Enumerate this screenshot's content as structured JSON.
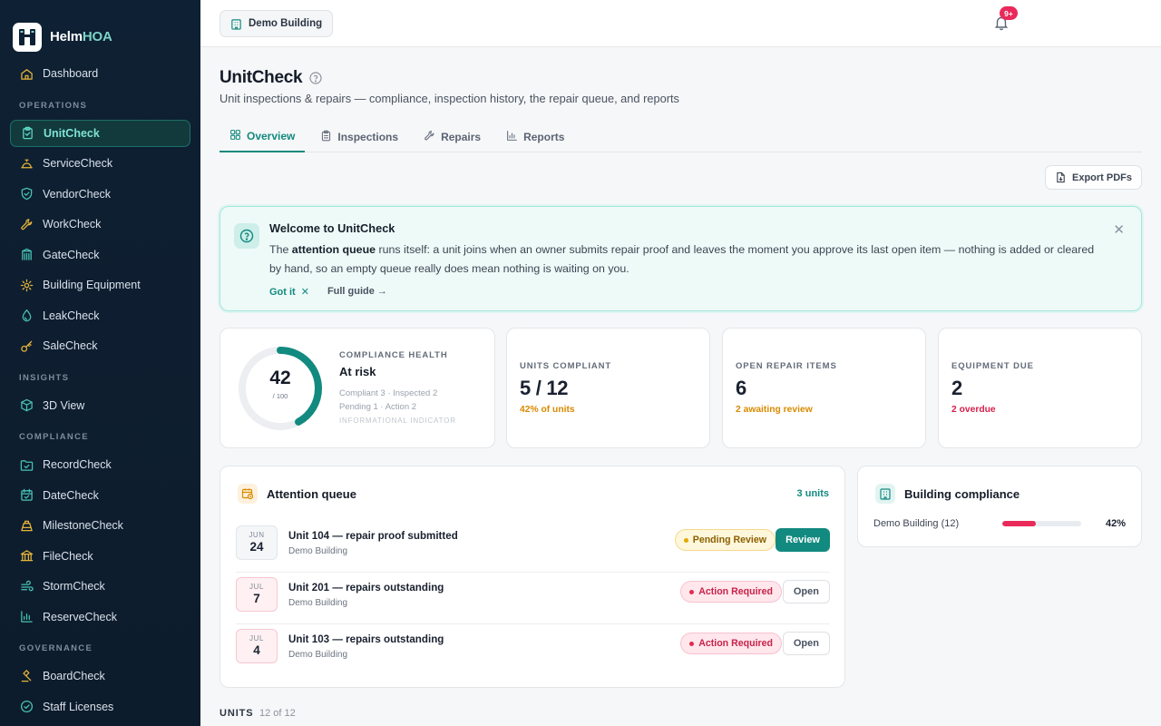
{
  "brand": {
    "name_a": "Helm",
    "name_b": "HOA"
  },
  "sidebar": {
    "top": [
      {
        "label": "Dashboard",
        "icon": "home-icon"
      }
    ],
    "sections": [
      {
        "title": "OPERATIONS",
        "items": [
          {
            "label": "UnitCheck",
            "icon": "clipboard-icon",
            "active": true
          },
          {
            "label": "ServiceCheck",
            "icon": "bell-service-icon"
          },
          {
            "label": "VendorCheck",
            "icon": "shield-check-icon"
          },
          {
            "label": "WorkCheck",
            "icon": "wrench-icon"
          },
          {
            "label": "GateCheck",
            "icon": "gate-icon"
          },
          {
            "label": "Building Equipment",
            "icon": "cog-icon"
          },
          {
            "label": "LeakCheck",
            "icon": "droplet-icon"
          },
          {
            "label": "SaleCheck",
            "icon": "key-icon"
          }
        ]
      },
      {
        "title": "INSIGHTS",
        "items": [
          {
            "label": "3D View",
            "icon": "cube-icon"
          }
        ]
      },
      {
        "title": "COMPLIANCE",
        "items": [
          {
            "label": "RecordCheck",
            "icon": "folder-check-icon"
          },
          {
            "label": "DateCheck",
            "icon": "calendar-check-icon"
          },
          {
            "label": "MilestoneCheck",
            "icon": "milestone-icon"
          },
          {
            "label": "FileCheck",
            "icon": "bank-icon"
          },
          {
            "label": "StormCheck",
            "icon": "wind-icon"
          },
          {
            "label": "ReserveCheck",
            "icon": "bar-chart-icon"
          }
        ]
      },
      {
        "title": "GOVERNANCE",
        "items": [
          {
            "label": "BoardCheck",
            "icon": "gavel-icon"
          },
          {
            "label": "Staff Licenses",
            "icon": "badge-check-icon"
          }
        ]
      }
    ]
  },
  "topbar": {
    "building": "Demo Building",
    "notifications": "9+"
  },
  "page": {
    "title": "UnitCheck",
    "subtitle": "Unit inspections & repairs — compliance, inspection history, the repair queue, and reports",
    "tabs": [
      {
        "label": "Overview",
        "icon": "grid-icon",
        "active": true
      },
      {
        "label": "Inspections",
        "icon": "clipboard-list-icon"
      },
      {
        "label": "Repairs",
        "icon": "wrench-icon"
      },
      {
        "label": "Reports",
        "icon": "bar-chart-icon"
      }
    ],
    "export_label": "Export PDFs"
  },
  "welcome": {
    "title": "Welcome to UnitCheck",
    "body_pre": "The ",
    "body_bold": "attention queue",
    "body_post": " runs itself: a unit joins when an owner submits repair proof and leaves the moment you approve its last open item — nothing is added or cleared by hand, so an empty queue really does mean nothing is waiting on you.",
    "got_it": "Got it",
    "full_guide": "Full guide →"
  },
  "health": {
    "score": "42",
    "denominator": "/ 100",
    "score_fraction": 0.42,
    "label": "COMPLIANCE HEALTH",
    "status": "At risk",
    "line1": "Compliant 3 · Inspected 2",
    "line2": "Pending 1 · Action 2",
    "note": "INFORMATIONAL INDICATOR",
    "ring_color": "#128a7f"
  },
  "stats": [
    {
      "label": "UNITS COMPLIANT",
      "value": "5 / 12",
      "sub": "42% of units",
      "sub_color": "#d98a00"
    },
    {
      "label": "OPEN REPAIR ITEMS",
      "value": "6",
      "sub": "2 awaiting review",
      "sub_color": "#d98a00"
    },
    {
      "label": "EQUIPMENT DUE",
      "value": "2",
      "sub": "2 overdue",
      "sub_color": "#d61f4c"
    }
  ],
  "attention": {
    "title": "Attention queue",
    "count": "3 units",
    "rows": [
      {
        "mon": "JUN",
        "day": "24",
        "name": "Unit 104 — repair proof submitted",
        "bldg": "Demo Building",
        "status": "Pending Review",
        "action": "Review"
      },
      {
        "mon": "JUL",
        "day": "7",
        "name": "Unit 201 — repairs outstanding",
        "bldg": "Demo Building",
        "status": "Action Required",
        "action": "Open"
      },
      {
        "mon": "JUL",
        "day": "4",
        "name": "Unit 103 — repairs outstanding",
        "bldg": "Demo Building",
        "status": "Action Required",
        "action": "Open"
      }
    ]
  },
  "building_compliance": {
    "title": "Building compliance",
    "rows": [
      {
        "name": "Demo Building (12)",
        "pct": "42%",
        "fraction": 0.42
      }
    ]
  },
  "units": {
    "label": "UNITS",
    "count": "12 of 12"
  },
  "colors": {
    "accent": "#128a7f",
    "danger": "#e9295b",
    "warning": "#e4a800",
    "sidebar": "#0e2033"
  }
}
